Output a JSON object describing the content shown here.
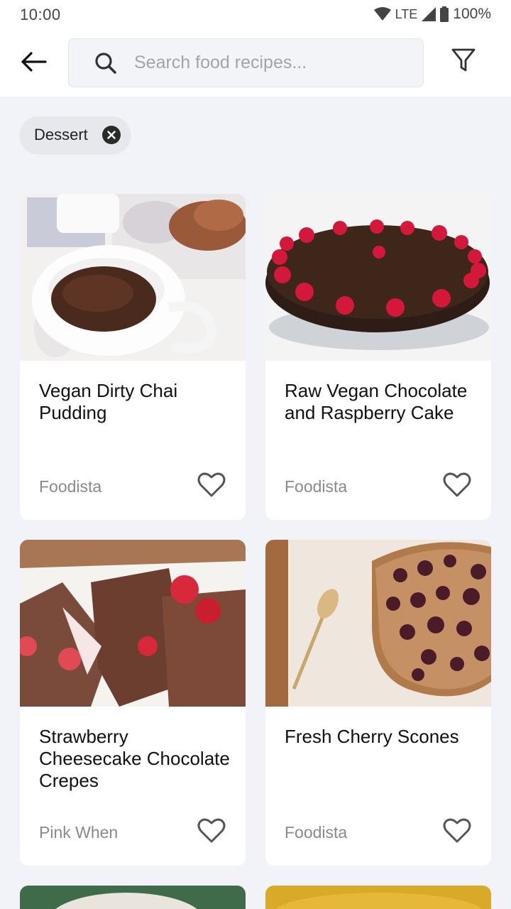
{
  "status_bar": {
    "time": "10:00",
    "network": "LTE",
    "battery": "100%"
  },
  "header": {
    "back_icon": "arrow-left-icon",
    "search_placeholder": "Search food recipes...",
    "search_value": "",
    "filter_icon": "funnel-filter-icon"
  },
  "filters": {
    "active_chip": "Dessert"
  },
  "recipes": [
    {
      "title": "Vegan Dirty Chai Pudding",
      "source": "Foodista"
    },
    {
      "title": "Raw Vegan Chocolate and Raspberry Cake",
      "source": "Foodista"
    },
    {
      "title": "Strawberry Cheesecake Chocolate Crepes",
      "source": "Pink When"
    },
    {
      "title": "Fresh Cherry Scones",
      "source": "Foodista"
    }
  ],
  "colors": {
    "page_background": "#f1f3f8",
    "card_background": "#ffffff",
    "source_text": "#888a90"
  }
}
